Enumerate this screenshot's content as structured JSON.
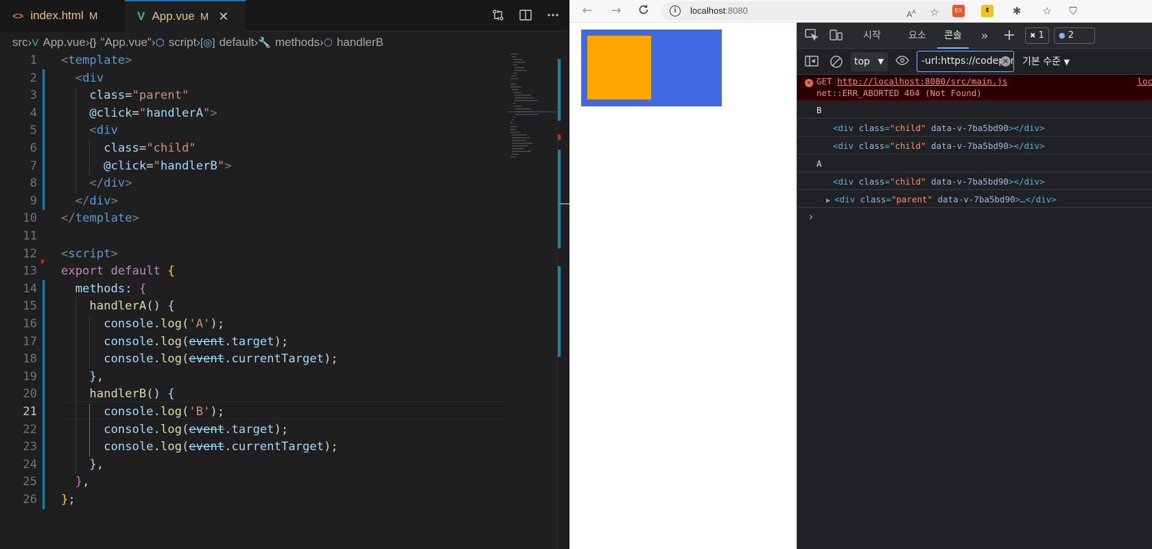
{
  "vscode": {
    "tabs": [
      {
        "icon": "<>",
        "label": "index.html",
        "status": "M"
      },
      {
        "icon": "V",
        "label": "App.vue",
        "status": "M",
        "close": "✕"
      }
    ],
    "breadcrumb": [
      {
        "label": "src",
        "icon": ""
      },
      {
        "label": "App.vue",
        "icon": "V"
      },
      {
        "label": "\"App.vue\"",
        "icon": "{}"
      },
      {
        "label": "script",
        "icon": "⬡"
      },
      {
        "label": "default",
        "icon": "[◎]"
      },
      {
        "label": "methods",
        "icon": "🔧"
      },
      {
        "label": "handlerB",
        "icon": "⬡"
      }
    ],
    "current_line": 21,
    "code_lines": [
      [
        [
          "tg",
          "<"
        ],
        [
          "tn",
          "template"
        ],
        [
          "tg",
          ">"
        ]
      ],
      [
        [
          "pl",
          "  "
        ],
        [
          "tg",
          "<"
        ],
        [
          "tn",
          "div"
        ]
      ],
      [
        [
          "pl",
          "    "
        ],
        [
          "at",
          "class"
        ],
        [
          "pl",
          "="
        ],
        [
          "st",
          "\"parent\""
        ]
      ],
      [
        [
          "pl",
          "    "
        ],
        [
          "at",
          "@click"
        ],
        [
          "pl",
          "="
        ],
        [
          "st",
          "\""
        ],
        [
          "at",
          "handlerA"
        ],
        [
          "st",
          "\""
        ],
        [
          "tg",
          ">"
        ]
      ],
      [
        [
          "pl",
          "    "
        ],
        [
          "tg",
          "<"
        ],
        [
          "tn",
          "div"
        ]
      ],
      [
        [
          "pl",
          "      "
        ],
        [
          "at",
          "class"
        ],
        [
          "pl",
          "="
        ],
        [
          "st",
          "\"child\""
        ]
      ],
      [
        [
          "pl",
          "      "
        ],
        [
          "at",
          "@click"
        ],
        [
          "pl",
          "="
        ],
        [
          "st",
          "\""
        ],
        [
          "at",
          "handlerB"
        ],
        [
          "st",
          "\""
        ],
        [
          "tg",
          ">"
        ]
      ],
      [
        [
          "pl",
          "    "
        ],
        [
          "tg",
          "</"
        ],
        [
          "tn",
          "div"
        ],
        [
          "tg",
          ">"
        ]
      ],
      [
        [
          "pl",
          "  "
        ],
        [
          "tg",
          "</"
        ],
        [
          "tn",
          "div"
        ],
        [
          "tg",
          ">"
        ]
      ],
      [
        [
          "tg",
          "</"
        ],
        [
          "tn",
          "template"
        ],
        [
          "tg",
          ">"
        ]
      ],
      [],
      [
        [
          "tg",
          "<"
        ],
        [
          "tn",
          "script"
        ],
        [
          "tg",
          ">"
        ]
      ],
      [
        [
          "kw",
          "export"
        ],
        [
          "pl",
          " "
        ],
        [
          "kw",
          "default"
        ],
        [
          "pl",
          " "
        ],
        [
          "pn",
          "{"
        ]
      ],
      [
        [
          "pl",
          "  "
        ],
        [
          "vr",
          "methods"
        ],
        [
          "pl",
          ": "
        ],
        [
          "pp",
          "{"
        ]
      ],
      [
        [
          "pl",
          "    "
        ],
        [
          "fn",
          "handlerA"
        ],
        [
          "pl",
          "() "
        ],
        [
          "vr",
          "{"
        ]
      ],
      [
        [
          "pl",
          "      "
        ],
        [
          "vr",
          "console"
        ],
        [
          "pl",
          "."
        ],
        [
          "fn",
          "log"
        ],
        [
          "pl",
          "("
        ],
        [
          "st",
          "'A'"
        ],
        [
          "pl",
          ");"
        ]
      ],
      [
        [
          "pl",
          "      "
        ],
        [
          "vr",
          "console"
        ],
        [
          "pl",
          "."
        ],
        [
          "fn",
          "log"
        ],
        [
          "pl",
          "("
        ],
        [
          "dep",
          "event"
        ],
        [
          "pl",
          "."
        ],
        [
          "vr",
          "target"
        ],
        [
          "pl",
          ");"
        ]
      ],
      [
        [
          "pl",
          "      "
        ],
        [
          "vr",
          "console"
        ],
        [
          "pl",
          "."
        ],
        [
          "fn",
          "log"
        ],
        [
          "pl",
          "("
        ],
        [
          "dep",
          "event"
        ],
        [
          "pl",
          "."
        ],
        [
          "vr",
          "currentTarget"
        ],
        [
          "pl",
          ");"
        ]
      ],
      [
        [
          "pl",
          "    "
        ],
        [
          "vr",
          "}"
        ],
        [
          "pl",
          ","
        ]
      ],
      [
        [
          "pl",
          "    "
        ],
        [
          "fn",
          "handlerB"
        ],
        [
          "pl",
          "() "
        ],
        [
          "vr",
          "{"
        ]
      ],
      [
        [
          "pl",
          "      "
        ],
        [
          "vr",
          "console"
        ],
        [
          "pl",
          "."
        ],
        [
          "fn",
          "log"
        ],
        [
          "pl",
          "("
        ],
        [
          "st",
          "'B'"
        ],
        [
          "pl",
          ");"
        ]
      ],
      [
        [
          "pl",
          "      "
        ],
        [
          "vr",
          "console"
        ],
        [
          "pl",
          "."
        ],
        [
          "fn",
          "log"
        ],
        [
          "pl",
          "("
        ],
        [
          "dep",
          "event"
        ],
        [
          "pl",
          "."
        ],
        [
          "vr",
          "target"
        ],
        [
          "pl",
          ");"
        ]
      ],
      [
        [
          "pl",
          "      "
        ],
        [
          "vr",
          "console"
        ],
        [
          "pl",
          "."
        ],
        [
          "fn",
          "log"
        ],
        [
          "pl",
          "("
        ],
        [
          "dep",
          "event"
        ],
        [
          "pl",
          "."
        ],
        [
          "vr",
          "currentTarget"
        ],
        [
          "pl",
          ");"
        ]
      ],
      [
        [
          "pl",
          "    "
        ],
        [
          "vr",
          "}"
        ],
        [
          "pl",
          ","
        ]
      ],
      [
        [
          "pl",
          "  "
        ],
        [
          "pp",
          "}"
        ],
        [
          "pl",
          ","
        ]
      ],
      [
        [
          "pn",
          "}"
        ],
        [
          "pl",
          ";"
        ]
      ]
    ]
  },
  "browser": {
    "address": {
      "host": "localhost",
      "port": ":8080"
    },
    "page": {
      "parent_color": "#4169e1",
      "child_color": "#ffa500"
    }
  },
  "devtools": {
    "tabs": {
      "start": "시작",
      "elements": "요소",
      "console": "콘솔"
    },
    "badges": {
      "issues": "1",
      "messages": "2"
    },
    "context": "top",
    "filter_value": "-url:https://codepen.io",
    "levels": "기본 수준",
    "error": {
      "method": "GET",
      "url": "http://localhost:8080/src/main.js",
      "message": "net::ERR_ABORTED 404 (Not Found)",
      "source": "loc"
    },
    "logs": [
      {
        "type": "text",
        "text": "B"
      },
      {
        "type": "dom",
        "tag": "div",
        "attr": "class",
        "value": "\"child\"",
        "extra": "data-v-7ba5bd90",
        "close": "></div>"
      },
      {
        "type": "dom",
        "tag": "div",
        "attr": "class",
        "value": "\"child\"",
        "extra": "data-v-7ba5bd90",
        "close": "></div>"
      },
      {
        "type": "text",
        "text": "A"
      },
      {
        "type": "dom",
        "tag": "div",
        "attr": "class",
        "value": "\"child\"",
        "extra": "data-v-7ba5bd90",
        "close": "></div>"
      },
      {
        "type": "dom",
        "tag": "div",
        "attr": "class",
        "value": "\"parent\"",
        "extra": "data-v-7ba5bd90",
        "close": ">…</div>",
        "expandable": true
      }
    ],
    "prompt": "›"
  }
}
